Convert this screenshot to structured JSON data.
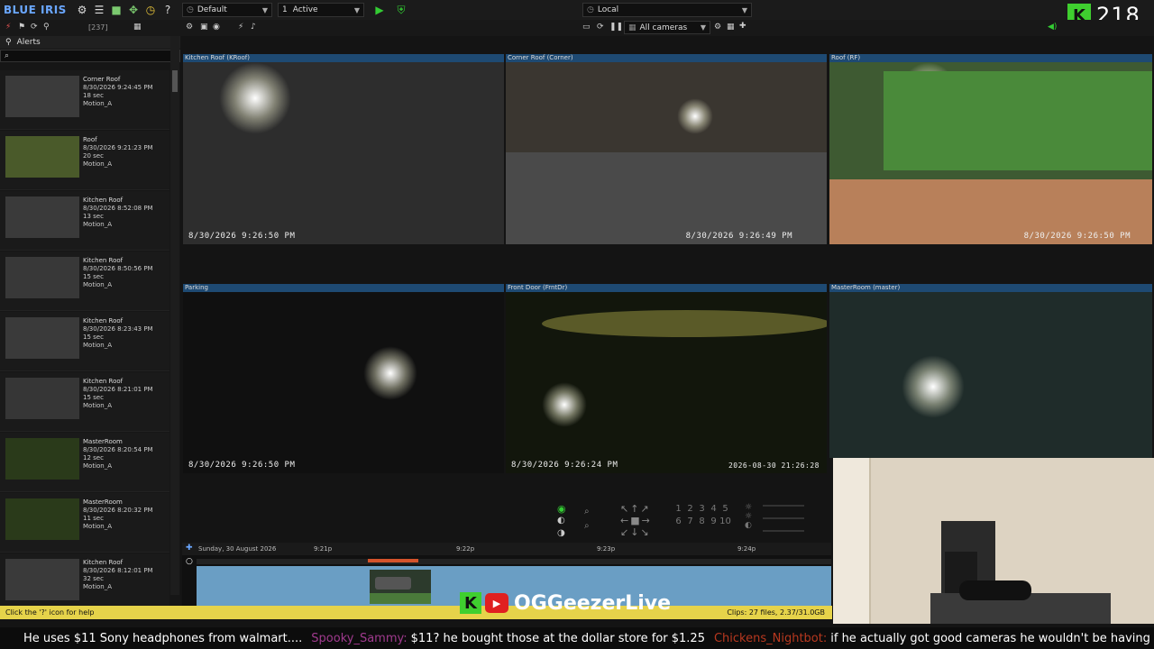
{
  "app": {
    "logo": "BLUE IRIS"
  },
  "toolbar": {
    "profile": "Default",
    "active_num": "1",
    "active_label": "Active",
    "location": "Local",
    "count": "[237]",
    "cameras_group": "All cameras"
  },
  "stream": {
    "counter": "218",
    "brand": "OGGeezerLive"
  },
  "alerts": {
    "header": "Alerts",
    "items": [
      {
        "cam": "Corner Roof",
        "time": "8/30/2026 9:24:45 PM",
        "dur": "18 sec",
        "trig": "Motion_A"
      },
      {
        "cam": "Roof",
        "time": "8/30/2026 9:21:23 PM",
        "dur": "20 sec",
        "trig": "Motion_A"
      },
      {
        "cam": "Kitchen Roof",
        "time": "8/30/2026 8:52:08 PM",
        "dur": "13 sec",
        "trig": "Motion_A"
      },
      {
        "cam": "Kitchen Roof",
        "time": "8/30/2026 8:50:56 PM",
        "dur": "15 sec",
        "trig": "Motion_A"
      },
      {
        "cam": "Kitchen Roof",
        "time": "8/30/2026 8:23:43 PM",
        "dur": "15 sec",
        "trig": "Motion_A"
      },
      {
        "cam": "Kitchen Roof",
        "time": "8/30/2026 8:21:01 PM",
        "dur": "15 sec",
        "trig": "Motion_A"
      },
      {
        "cam": "MasterRoom",
        "time": "8/30/2026 8:20:54 PM",
        "dur": "12 sec",
        "trig": "Motion_A"
      },
      {
        "cam": "MasterRoom",
        "time": "8/30/2026 8:20:32 PM",
        "dur": "11 sec",
        "trig": "Motion_A"
      },
      {
        "cam": "Kitchen Roof",
        "time": "8/30/2026 8:12:01 PM",
        "dur": "32 sec",
        "trig": "Motion_A"
      }
    ]
  },
  "cameras": [
    {
      "title": "Kitchen Roof (KRoof)",
      "stamp": "8/30/2026 9:26:50 PM"
    },
    {
      "title": "Corner Roof (Corner)",
      "stamp": "8/30/2026 9:26:49 PM"
    },
    {
      "title": "Roof (RF)",
      "stamp": "8/30/2026 9:26:50 PM"
    },
    {
      "title": "Parking",
      "stamp": "8/30/2026 9:26:50 PM"
    },
    {
      "title": "Front Door (FrntDr)",
      "stamp": "8/30/2026 9:26:24 PM",
      "stamp2": "2026-08-30 21:26:28"
    },
    {
      "title": "MasterRoom (master)",
      "stamp": ""
    }
  ],
  "ptz": {
    "presets": [
      "1",
      "2",
      "3",
      "4",
      "5",
      "6",
      "7",
      "8",
      "9",
      "10"
    ]
  },
  "timeline": {
    "date": "Sunday, 30 August 2026",
    "ticks": [
      "9:21p",
      "9:22p",
      "9:23p",
      "9:24p"
    ]
  },
  "status": {
    "help": "Click the '?' icon for help",
    "clips": "Clips: 27 files, 2.37/31.0GB"
  },
  "chat": [
    {
      "user": "",
      "msg": "He uses $11 Sony headphones from walmart...."
    },
    {
      "user": "Spooky_Sammy:",
      "msg": "$11? he bought those at the dollar store for $1.25"
    },
    {
      "user": "Chickens_Nightbot:",
      "msg": "if he actually got good cameras he wouldn't be having this problem"
    }
  ],
  "colors": {
    "accent": "#1e4a73",
    "status": "#e6d34a",
    "timeline": "#6a9ec4"
  }
}
